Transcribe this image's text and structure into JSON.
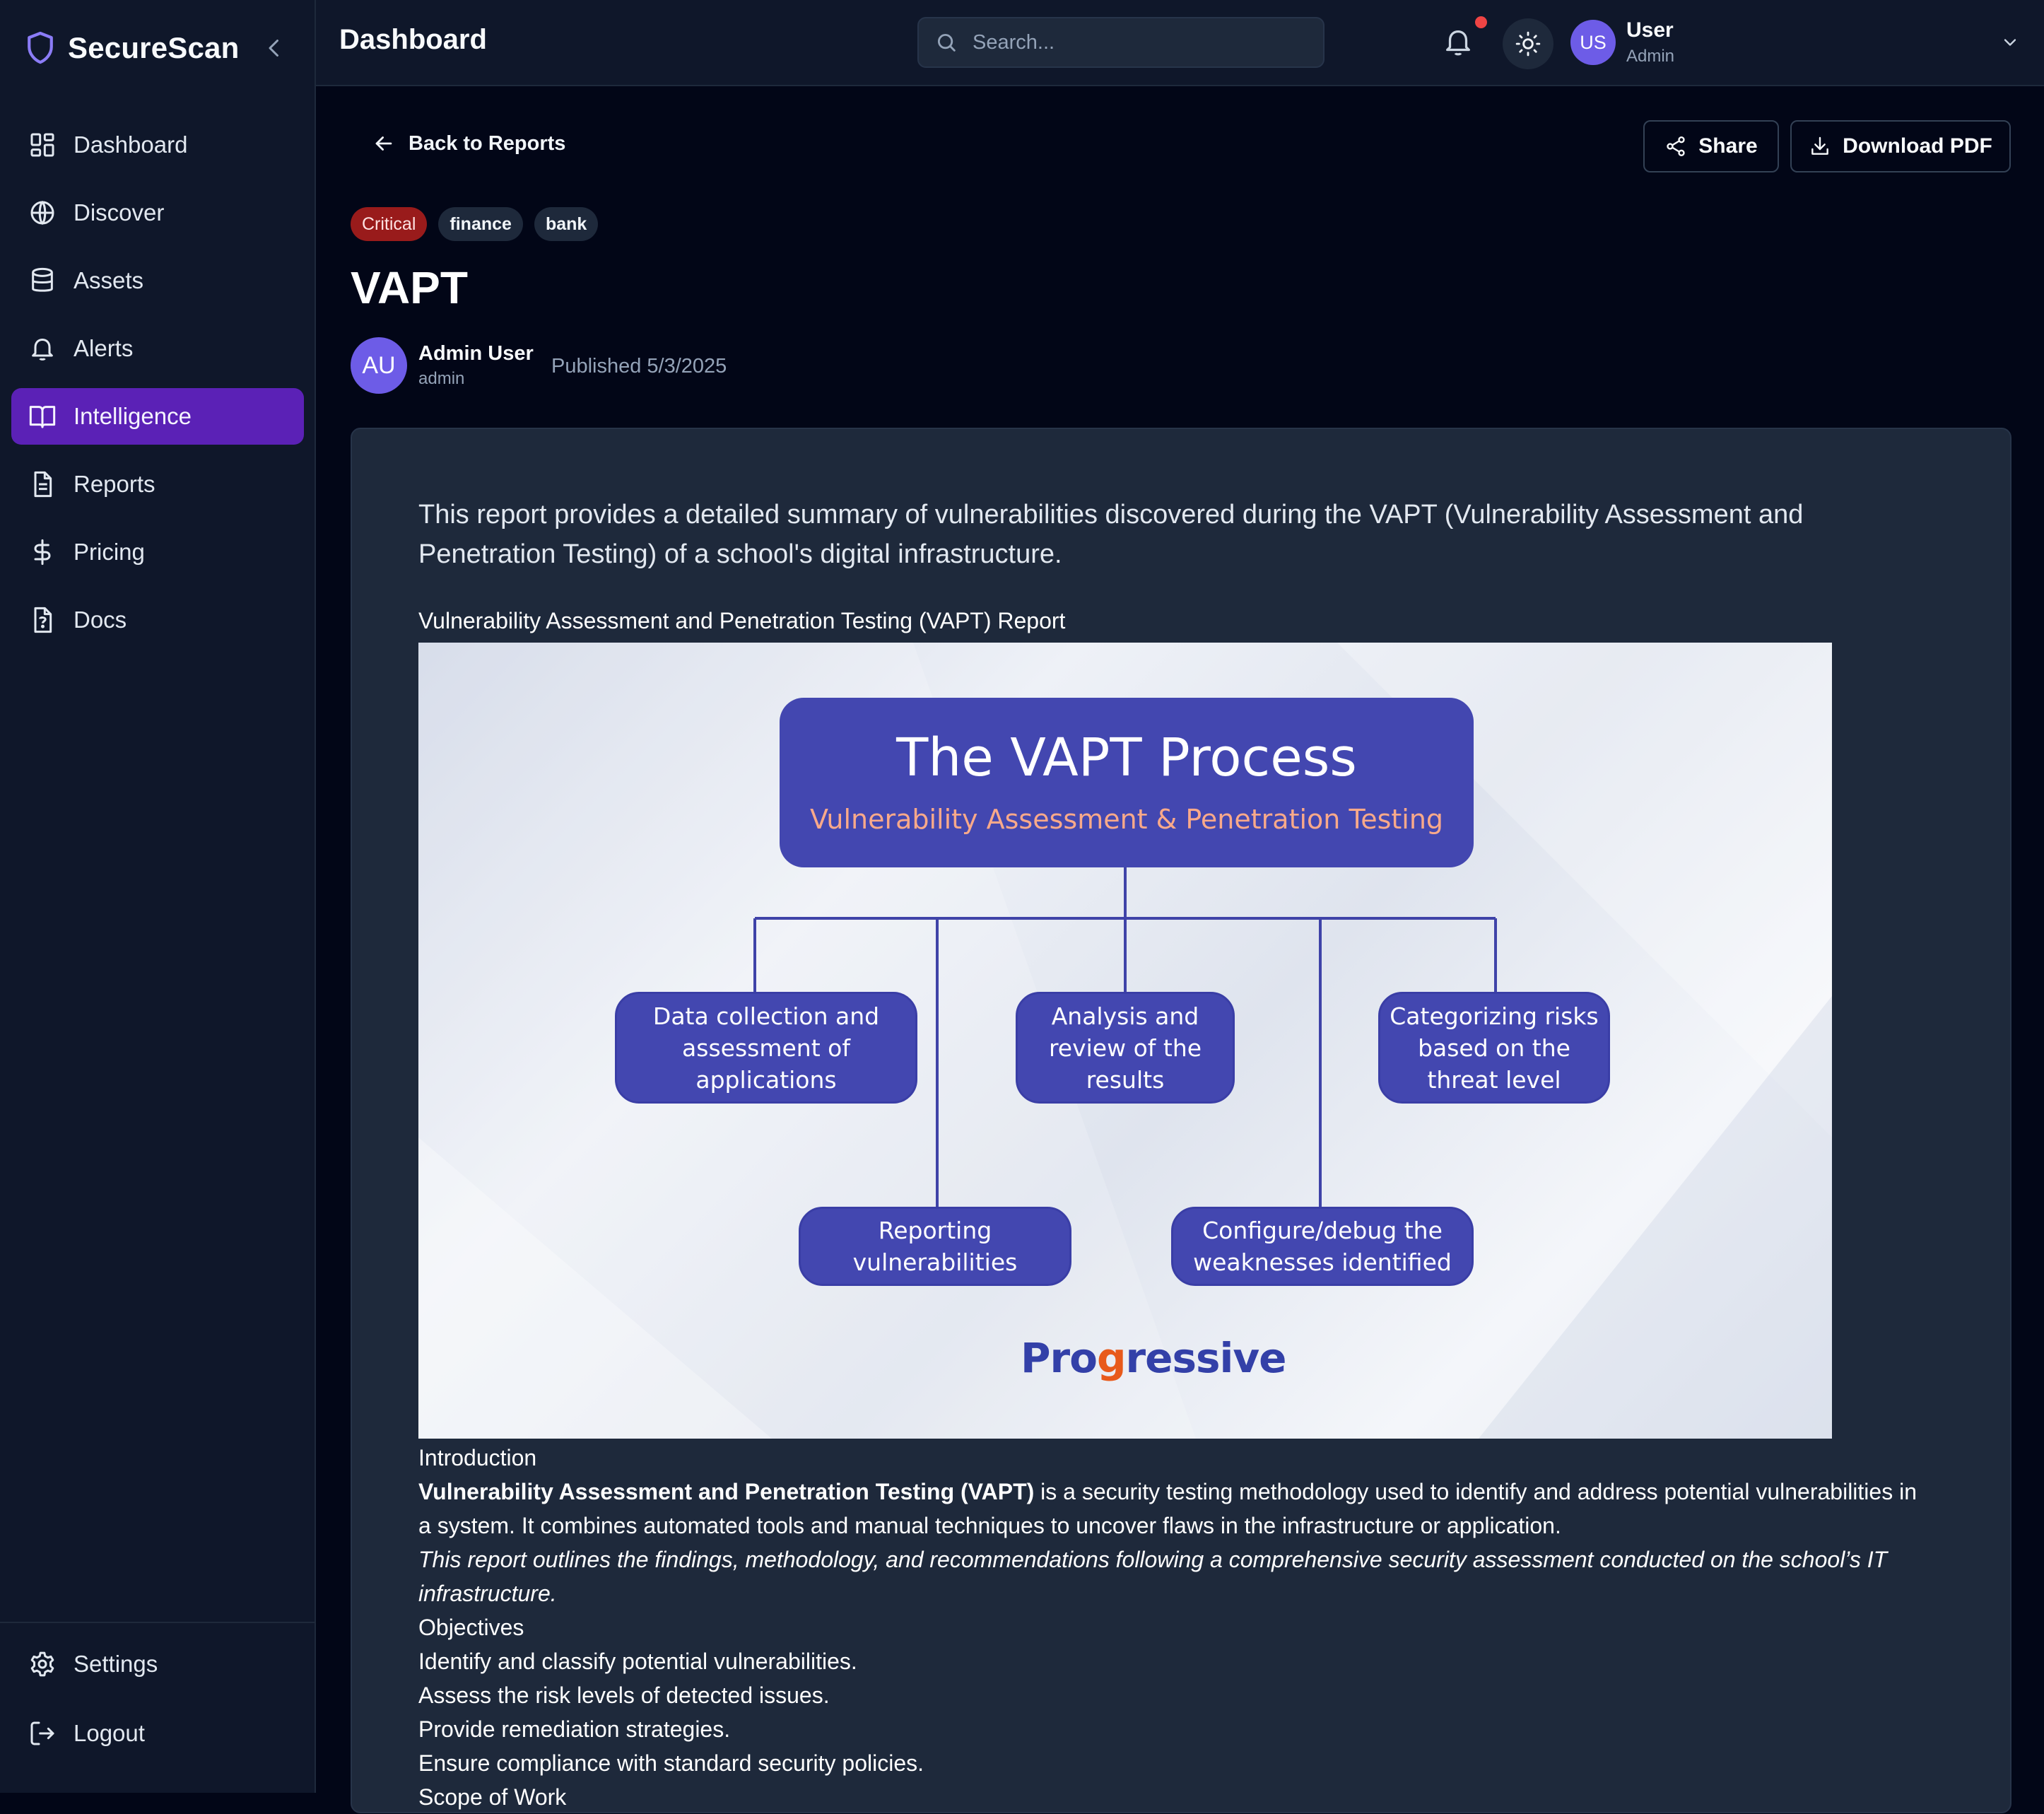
{
  "app": {
    "brand": "SecureScan",
    "page_title": "Dashboard"
  },
  "sidebar": {
    "items": [
      {
        "label": "Dashboard",
        "icon": "dashboard-grid-icon"
      },
      {
        "label": "Discover",
        "icon": "globe-icon"
      },
      {
        "label": "Assets",
        "icon": "database-icon"
      },
      {
        "label": "Alerts",
        "icon": "bell-icon"
      },
      {
        "label": "Intelligence",
        "icon": "book-open-icon",
        "active": true
      },
      {
        "label": "Reports",
        "icon": "file-text-icon"
      },
      {
        "label": "Pricing",
        "icon": "dollar-icon"
      },
      {
        "label": "Docs",
        "icon": "file-question-icon"
      }
    ],
    "bottom": [
      {
        "label": "Settings",
        "icon": "gear-icon"
      },
      {
        "label": "Logout",
        "icon": "logout-icon"
      }
    ]
  },
  "header": {
    "search_placeholder": "Search...",
    "user": {
      "initials": "US",
      "name": "User",
      "role": "Admin"
    },
    "notification_dot_color": "#ef4444"
  },
  "report": {
    "back_label": "Back to Reports",
    "share_label": "Share",
    "download_label": "Download PDF",
    "tags": {
      "severity": "Critical",
      "t1": "finance",
      "t2": "bank"
    },
    "title": "VAPT",
    "author": {
      "initials": "AU",
      "name": "Admin User",
      "role": "admin"
    },
    "published": "Published 5/3/2025",
    "summary": "This report provides a detailed summary of vulnerabilities discovered during the VAPT (Vulnerability Assessment and Penetration Testing) of a school's digital infrastructure.",
    "image_caption": "Vulnerability Assessment and Penetration Testing (VAPT) Report",
    "figure": {
      "title": "The VAPT Process",
      "subtitle": "Vulnerability Assessment & Penetration Testing",
      "boxes": {
        "b1": "Data collection and assessment of applications",
        "b2": "Analysis and review of the results",
        "b3": "Categorizing risks based on the threat level",
        "b4": "Reporting vulnerabilities",
        "b5": "Configure/debug the weaknesses identified"
      },
      "logo_a": "Pro",
      "logo_b": "g",
      "logo_c": "ressive"
    },
    "body": {
      "intro_heading": "Introduction",
      "intro_bold": "Vulnerability Assessment and Penetration Testing (VAPT)",
      "intro_rest": " is a security testing methodology used to identify and address potential vulnerabilities in a system. It combines automated tools and manual techniques to uncover flaws in the infrastructure or application.",
      "intro_italic": "This report outlines the findings, methodology, and recommendations following a comprehensive security assessment conducted on the school’s IT infrastructure.",
      "objectives_heading": "Objectives",
      "objectives": [
        "Identify and classify potential vulnerabilities.",
        "Assess the risk levels of detected issues.",
        "Provide remediation strategies.",
        "Ensure compliance with standard security policies."
      ],
      "scope_heading": "Scope of Work"
    }
  },
  "colors": {
    "background": "#020617",
    "sidebar": "#0f172a",
    "card": "#1e293b",
    "accent": "#5b21b6",
    "critical": "#991b1b",
    "avatar": "#6d5ce7",
    "figure_box": "#4347b0"
  }
}
